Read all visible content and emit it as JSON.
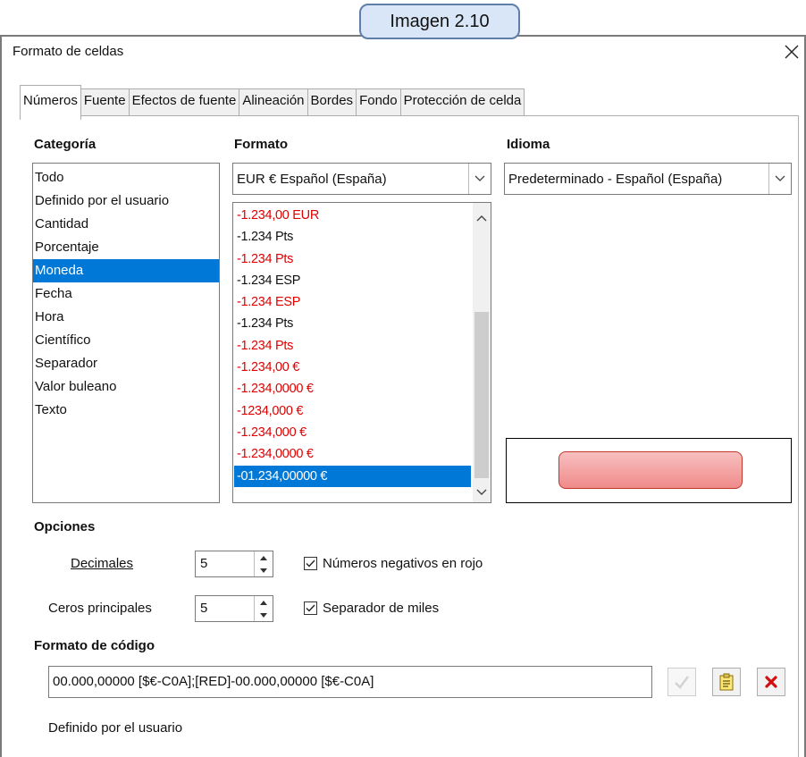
{
  "badge": "Imagen 2.10",
  "dialog": {
    "title": "Formato de celdas",
    "close_symbol": "✕"
  },
  "tabs": [
    {
      "label": "Números"
    },
    {
      "label": "Fuente"
    },
    {
      "label": "Efectos de fuente"
    },
    {
      "label": "Alineación"
    },
    {
      "label": "Bordes"
    },
    {
      "label": "Fondo"
    },
    {
      "label": "Protección de celda"
    }
  ],
  "categoria": {
    "label": "Categoría",
    "items": [
      "Todo",
      "Definido por el usuario",
      "Cantidad",
      "Porcentaje",
      "Moneda",
      "Fecha",
      "Hora",
      "Científico",
      "Separador",
      "Valor buleano",
      "Texto"
    ],
    "selected": "Moneda"
  },
  "formato": {
    "label": "Formato",
    "selected_value": "EUR  €  Español (España)",
    "items": [
      {
        "text": "-1.234,00 EUR",
        "color": "red"
      },
      {
        "text": "-1.234 Pts",
        "color": "black"
      },
      {
        "text": "-1.234 Pts",
        "color": "red"
      },
      {
        "text": "-1.234 ESP",
        "color": "black"
      },
      {
        "text": "-1.234 ESP",
        "color": "red"
      },
      {
        "text": "-1.234 Pts",
        "color": "black"
      },
      {
        "text": "-1.234 Pts",
        "color": "red"
      },
      {
        "text": "-1.234,00 €",
        "color": "red"
      },
      {
        "text": "-1.234,0000 €",
        "color": "red"
      },
      {
        "text": "-1234,000 €",
        "color": "red"
      },
      {
        "text": "-1.234,000 €",
        "color": "red"
      },
      {
        "text": "-1.234,0000 €",
        "color": "red"
      },
      {
        "text": "-01.234,00000 €",
        "color": "selected"
      }
    ]
  },
  "idioma": {
    "label": "Idioma",
    "selected_value": "Predeterminado - Español (España)"
  },
  "opciones": {
    "label": "Opciones",
    "decimales": {
      "label": "Decimales",
      "value": "5"
    },
    "ceros": {
      "label": "Ceros principales",
      "value": "5"
    },
    "negativos_rojo": {
      "label": "Números negativos en rojo",
      "checked": true
    },
    "separador_miles": {
      "label": "Separador de miles",
      "checked": true
    }
  },
  "codigo": {
    "label": "Formato de código",
    "value": "00.000,00000 [$€-C0A];[RED]-00.000,00000 [$€-C0A]",
    "description": "Definido por el usuario"
  },
  "colors": {
    "accent": "#0078d7",
    "negative": "#e00000",
    "preview_fill": "#f4a6a6",
    "preview_border": "#c0392b"
  }
}
